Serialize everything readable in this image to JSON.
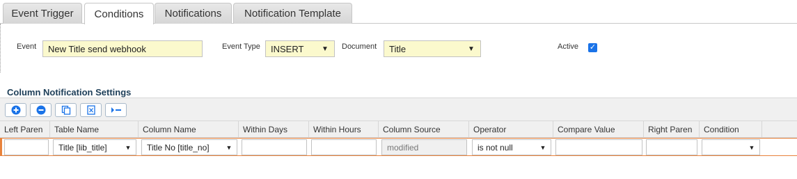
{
  "tabs": [
    {
      "label": "Event Trigger",
      "active": false
    },
    {
      "label": "Conditions",
      "active": true
    },
    {
      "label": "Notifications",
      "active": false
    },
    {
      "label": "Notification Template",
      "active": false
    }
  ],
  "form": {
    "event_label": "Event",
    "event_value": "New Title send webhook",
    "event_type_label": "Event Type",
    "event_type_value": "INSERT",
    "document_label": "Document",
    "document_value": "Title",
    "active_label": "Active",
    "active_checked": true
  },
  "section_title": "Column Notification Settings",
  "toolbar": {
    "buttons": [
      "add-icon",
      "remove-icon",
      "copy-icon",
      "excel-export-icon",
      "indent-icon"
    ]
  },
  "grid": {
    "columns": [
      "Left Paren",
      "Table Name",
      "Column Name",
      "Within Days",
      "Within Hours",
      "Column Source",
      "Operator",
      "Compare Value",
      "Right Paren",
      "Condition"
    ],
    "row": {
      "left_paren": "",
      "table_name": "Title [lib_title]",
      "column_name": "Title No [title_no]",
      "within_days": "",
      "within_hours": "",
      "column_source": "modified",
      "operator": "is not null",
      "compare_value": "",
      "right_paren": "",
      "condition": ""
    }
  },
  "colors": {
    "field_bg": "#fbf9cd",
    "accent_blue": "#1a73e8",
    "row_highlight": "#e8823b",
    "section_title": "#1d3e58"
  }
}
